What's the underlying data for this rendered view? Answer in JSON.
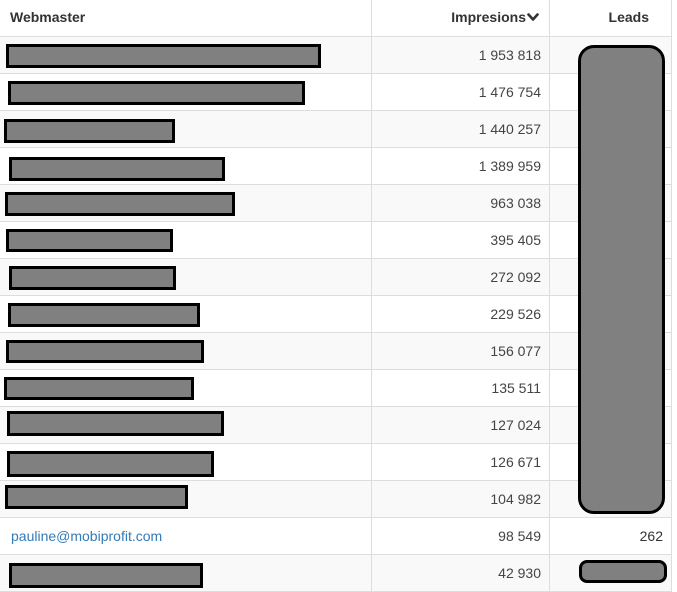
{
  "table": {
    "columns": {
      "webmaster": "Webmaster",
      "impressions": "Impresions",
      "leads": "Leads"
    },
    "sort": {
      "column": "impressions",
      "direction": "descending",
      "icon": "chevron-down-icon"
    },
    "rows": [
      {
        "webmaster": "",
        "impressions": "1 953 818",
        "leads": ""
      },
      {
        "webmaster": "",
        "impressions": "1 476 754",
        "leads": ""
      },
      {
        "webmaster": "",
        "impressions": "1 440 257",
        "leads": ""
      },
      {
        "webmaster": "",
        "impressions": "1 389 959",
        "leads": ""
      },
      {
        "webmaster": "",
        "impressions": "963 038",
        "leads": ""
      },
      {
        "webmaster": "",
        "impressions": "395 405",
        "leads": ""
      },
      {
        "webmaster": "",
        "impressions": "272 092",
        "leads": ""
      },
      {
        "webmaster": "",
        "impressions": "229 526",
        "leads": ""
      },
      {
        "webmaster": "",
        "impressions": "156 077",
        "leads": ""
      },
      {
        "webmaster": "",
        "impressions": "135 511",
        "leads": ""
      },
      {
        "webmaster": "",
        "impressions": "127 024",
        "leads": ""
      },
      {
        "webmaster": "",
        "impressions": "126 671",
        "leads": ""
      },
      {
        "webmaster": "",
        "impressions": "104 982",
        "leads": ""
      },
      {
        "webmaster": "pauline@mobiprofit.com",
        "impressions": "98 549",
        "leads": "262"
      },
      {
        "webmaster": "",
        "impressions": "42 930",
        "leads": ""
      }
    ]
  },
  "colors": {
    "link": "#337ab7",
    "border": "#dddddd",
    "stripe": "#f9f9f9",
    "redaction_fill": "#808080",
    "redaction_border": "#000000"
  }
}
